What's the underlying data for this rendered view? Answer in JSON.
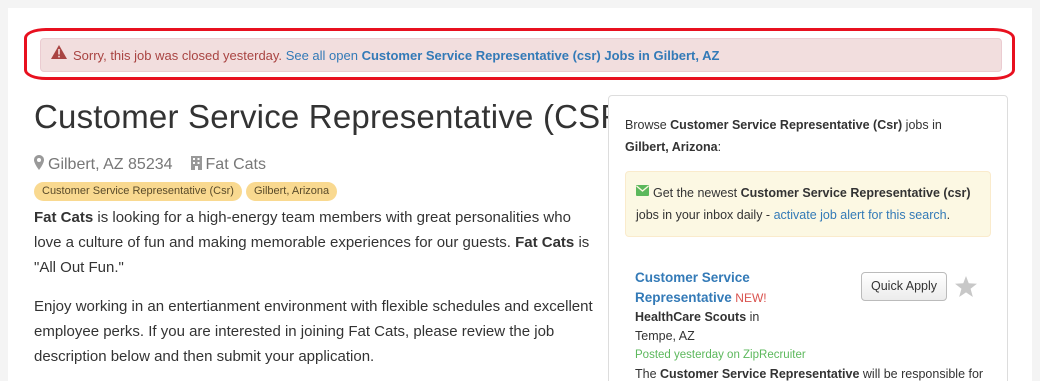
{
  "alert": {
    "message": "Sorry, this job was closed yesterday.",
    "link_prefix": "See all open",
    "link_bold": "Customer Service Representative (csr) Jobs in Gilbert, AZ"
  },
  "job": {
    "title": "Customer Service Representative (CSR)",
    "location": "Gilbert, AZ 85234",
    "company": "Fat Cats",
    "tags": [
      "Customer Service Representative (Csr)",
      "Gilbert, Arizona"
    ],
    "paragraph1": {
      "company_bold_1": "Fat Cats",
      "text_1": " is looking for a high-energy team members with great personalities who love a culture of fun and making memorable experiences for our guests. ",
      "company_bold_2": "Fat Cats",
      "text_2": " is \"All Out Fun.\""
    },
    "paragraph2": "Enjoy working in an entertianment environment with flexible schedules and excellent employee perks. If you are interested in joining Fat Cats, please review the job description below and then submit your application."
  },
  "sidebar": {
    "browse": {
      "prefix": "Browse ",
      "job_bold": "Customer Service Representative (Csr)",
      "middle": " jobs in",
      "location_bold": "Gilbert, Arizona",
      "suffix": ":"
    },
    "job_alert": {
      "prefix": "Get the newest ",
      "job_bold": "Customer Service Representative (csr)",
      "middle": "jobs in your inbox daily - ",
      "link": "activate job alert for this search",
      "suffix": "."
    },
    "listing": {
      "title": "Customer Service Representative",
      "badge": "NEW!",
      "company": "HealthCare Scouts",
      "company_suffix": " in",
      "location": "Tempe, AZ",
      "posted": "Posted yesterday on ZipRecruiter",
      "snippet_prefix": "The ",
      "snippet_bold": "Customer Service Representative",
      "snippet_suffix": " will be responsible for",
      "quick_apply": "Quick Apply"
    }
  },
  "colors": {
    "alert_bg": "#f2dede",
    "alert_text": "#a94442",
    "link": "#337ab7",
    "tag_bg": "#f9d990",
    "highlight_outline": "#e8101f"
  },
  "icons": [
    "warning-icon",
    "map-marker-icon",
    "building-icon",
    "envelope-icon",
    "star-icon"
  ]
}
